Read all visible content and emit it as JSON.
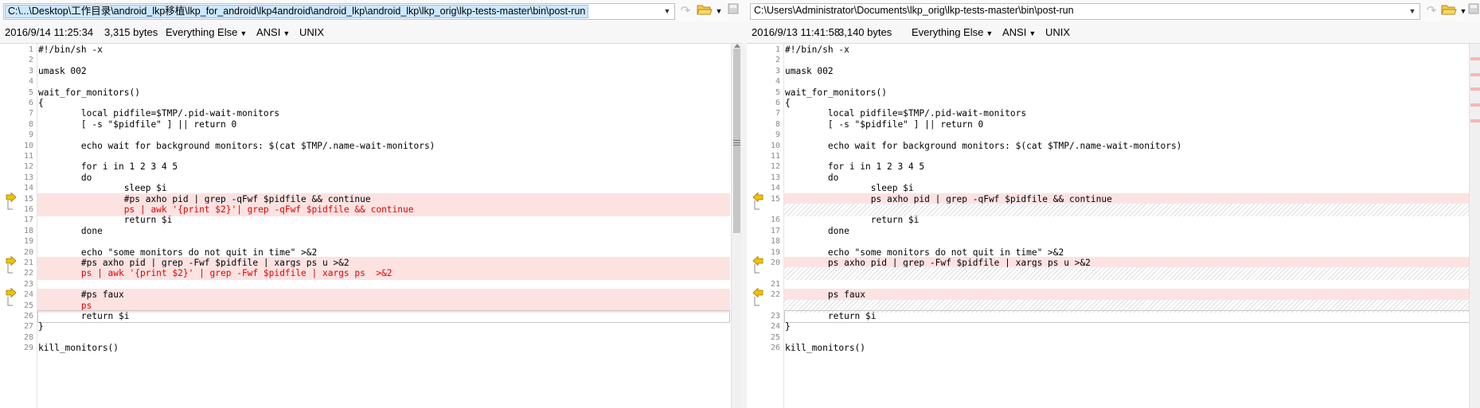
{
  "left": {
    "path": "C:\\...\\Desktop\\工作目录\\android_lkp移植\\lkp_for_android\\lkp4android\\android_lkp\\android_lkp\\lkp_orig\\lkp-tests-master\\bin\\post-run",
    "date": "2016/9/14 11:25:34",
    "size": "3,315 bytes",
    "filter": "Everything Else",
    "encoding": "ANSI",
    "line_ending": "UNIX",
    "rows": [
      {
        "n": "1",
        "t": "#!/bin/sh -x"
      },
      {
        "n": "2",
        "t": ""
      },
      {
        "n": "3",
        "t": "umask 002"
      },
      {
        "n": "4",
        "t": ""
      },
      {
        "n": "5",
        "t": "wait_for_monitors()"
      },
      {
        "n": "6",
        "t": "{"
      },
      {
        "n": "7",
        "t": "        local pidfile=$TMP/.pid-wait-monitors"
      },
      {
        "n": "8",
        "t": "        [ -s \"$pidfile\" ] || return 0"
      },
      {
        "n": "9",
        "t": ""
      },
      {
        "n": "10",
        "t": "        echo wait for background monitors: $(cat $TMP/.name-wait-monitors)"
      },
      {
        "n": "11",
        "t": ""
      },
      {
        "n": "12",
        "t": "        for i in 1 2 3 4 5"
      },
      {
        "n": "13",
        "t": "        do"
      },
      {
        "n": "14",
        "t": "                sleep $i"
      },
      {
        "n": "15",
        "t": "                #ps axho pid | grep -qFwf $pidfile && continue",
        "k": "diff",
        "m": "start"
      },
      {
        "n": "16",
        "t": "                ps | awk '{print $2}'| grep -qFwf $pidfile && continue",
        "k": "diff red",
        "m": "end"
      },
      {
        "n": "17",
        "t": "                return $i"
      },
      {
        "n": "18",
        "t": "        done"
      },
      {
        "n": "19",
        "t": ""
      },
      {
        "n": "20",
        "t": "        echo \"some monitors do not quit in time\" >&2"
      },
      {
        "n": "21",
        "t": "        #ps axho pid | grep -Fwf $pidfile | xargs ps u >&2",
        "k": "diff",
        "m": "start"
      },
      {
        "n": "22",
        "t": "        ps | awk '{print $2}' | grep -Fwf $pidfile | xargs ps  >&2",
        "k": "diff red",
        "m": "end"
      },
      {
        "n": "23",
        "t": ""
      },
      {
        "n": "24",
        "t": "        #ps faux",
        "k": "diff",
        "m": "start"
      },
      {
        "n": "25",
        "t": "        ps",
        "k": "diff red",
        "m": "end"
      },
      {
        "n": "26",
        "t": "        return $i",
        "k": "cur"
      },
      {
        "n": "27",
        "t": "}"
      },
      {
        "n": "28",
        "t": ""
      },
      {
        "n": "29",
        "t": "kill_monitors()"
      }
    ]
  },
  "right": {
    "path": "C:\\Users\\Administrator\\Documents\\lkp_orig\\lkp-tests-master\\bin\\post-run",
    "date": "2016/9/13 11:41:58",
    "size": "3,140 bytes",
    "filter": "Everything Else",
    "encoding": "ANSI",
    "line_ending": "UNIX",
    "rows": [
      {
        "n": "1",
        "t": "#!/bin/sh -x"
      },
      {
        "n": "2",
        "t": ""
      },
      {
        "n": "3",
        "t": "umask 002"
      },
      {
        "n": "4",
        "t": ""
      },
      {
        "n": "5",
        "t": "wait_for_monitors()"
      },
      {
        "n": "6",
        "t": "{"
      },
      {
        "n": "7",
        "t": "        local pidfile=$TMP/.pid-wait-monitors"
      },
      {
        "n": "8",
        "t": "        [ -s \"$pidfile\" ] || return 0"
      },
      {
        "n": "9",
        "t": ""
      },
      {
        "n": "10",
        "t": "        echo wait for background monitors: $(cat $TMP/.name-wait-monitors)"
      },
      {
        "n": "11",
        "t": ""
      },
      {
        "n": "12",
        "t": "        for i in 1 2 3 4 5"
      },
      {
        "n": "13",
        "t": "        do"
      },
      {
        "n": "14",
        "t": "                sleep $i"
      },
      {
        "n": "15",
        "t": "                ps axho pid | grep -qFwf $pidfile && continue",
        "k": "diff",
        "m": "start"
      },
      {
        "n": "",
        "t": "",
        "k": "hatch",
        "m": "end"
      },
      {
        "n": "16",
        "t": "                return $i"
      },
      {
        "n": "17",
        "t": "        done"
      },
      {
        "n": "18",
        "t": ""
      },
      {
        "n": "19",
        "t": "        echo \"some monitors do not quit in time\" >&2"
      },
      {
        "n": "20",
        "t": "        ps axho pid | grep -Fwf $pidfile | xargs ps u >&2",
        "k": "diff",
        "m": "start"
      },
      {
        "n": "",
        "t": "",
        "k": "hatch",
        "m": "end"
      },
      {
        "n": "21",
        "t": ""
      },
      {
        "n": "22",
        "t": "        ps faux",
        "k": "diff",
        "m": "start"
      },
      {
        "n": "",
        "t": "",
        "k": "hatch",
        "m": "end"
      },
      {
        "n": "23",
        "t": "        return $i",
        "k": "cur"
      },
      {
        "n": "24",
        "t": "}"
      },
      {
        "n": "25",
        "t": ""
      },
      {
        "n": "26",
        "t": "kill_monitors()"
      }
    ]
  },
  "icons": {
    "dropdown": "chevron-down-icon",
    "nav": "navigate-icon",
    "open": "open-folder-icon",
    "save": "save-icon",
    "diff_marker": "diff-arrow-icon"
  },
  "colors": {
    "diff_bg": "#fde2e2",
    "changed_text": "#e60000",
    "marker": "#f2c200",
    "selection": "#cce8ff"
  }
}
